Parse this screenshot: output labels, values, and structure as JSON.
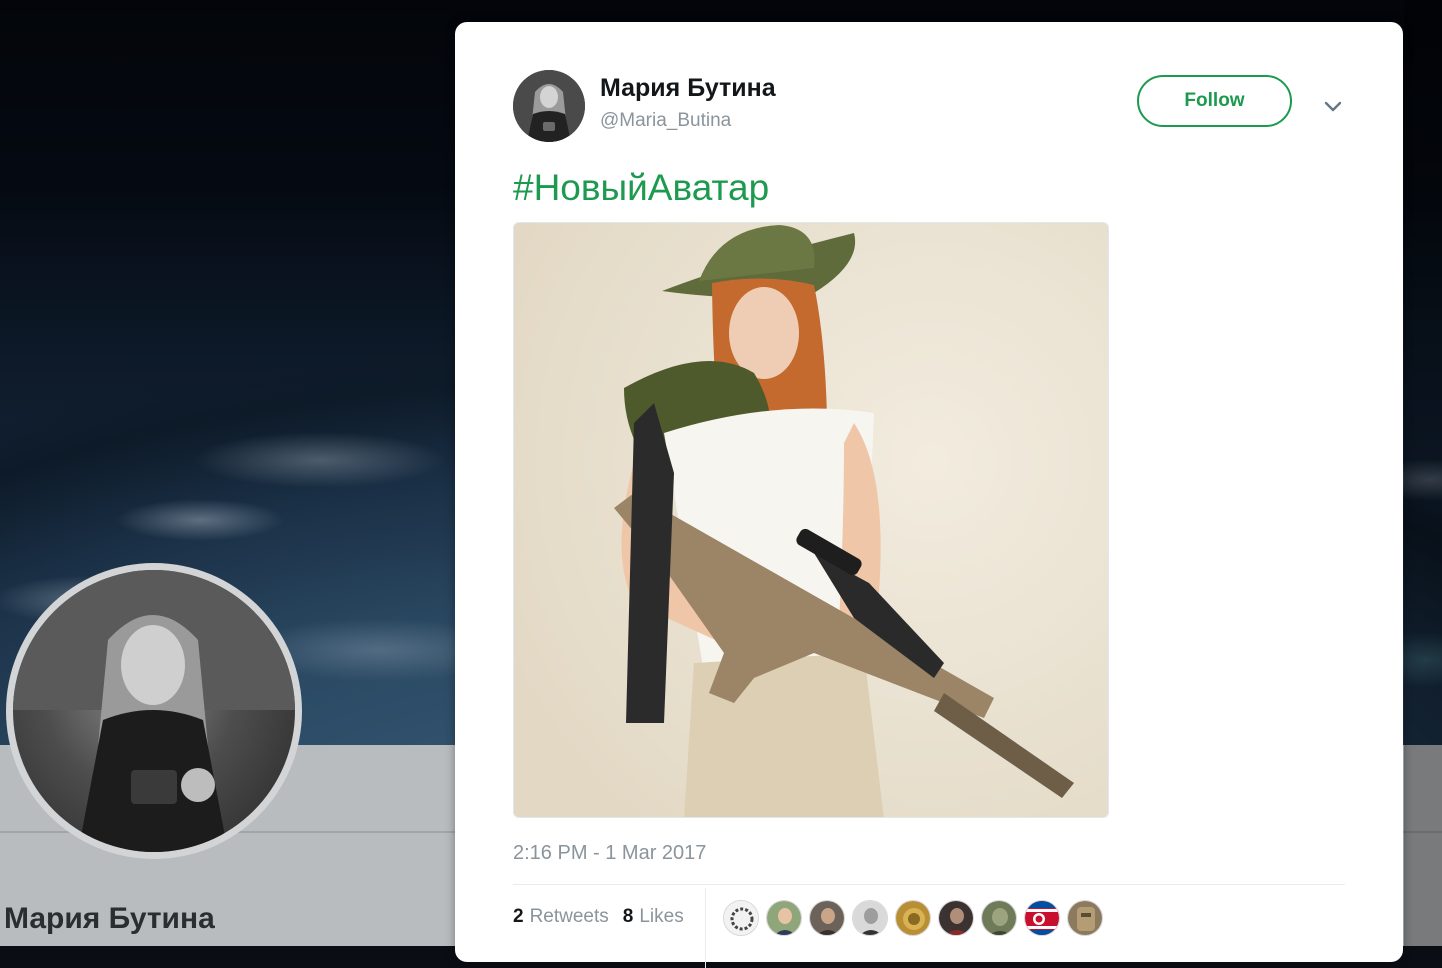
{
  "profile": {
    "name": "Мария Бутина"
  },
  "tweet": {
    "display_name": "Мария Бутина",
    "handle": "@Maria_Butina",
    "follow_label": "Follow",
    "text": "#НовыйАватар",
    "timestamp": "2:16 PM - 1 Mar 2017",
    "retweets_count": "2",
    "retweets_label": "Retweets",
    "likes_count": "8",
    "likes_label": "Likes"
  },
  "colors": {
    "accent": "#1d9a4f",
    "muted_text": "#8a949c"
  },
  "icons": {
    "chevron": "chevron-down-icon"
  }
}
